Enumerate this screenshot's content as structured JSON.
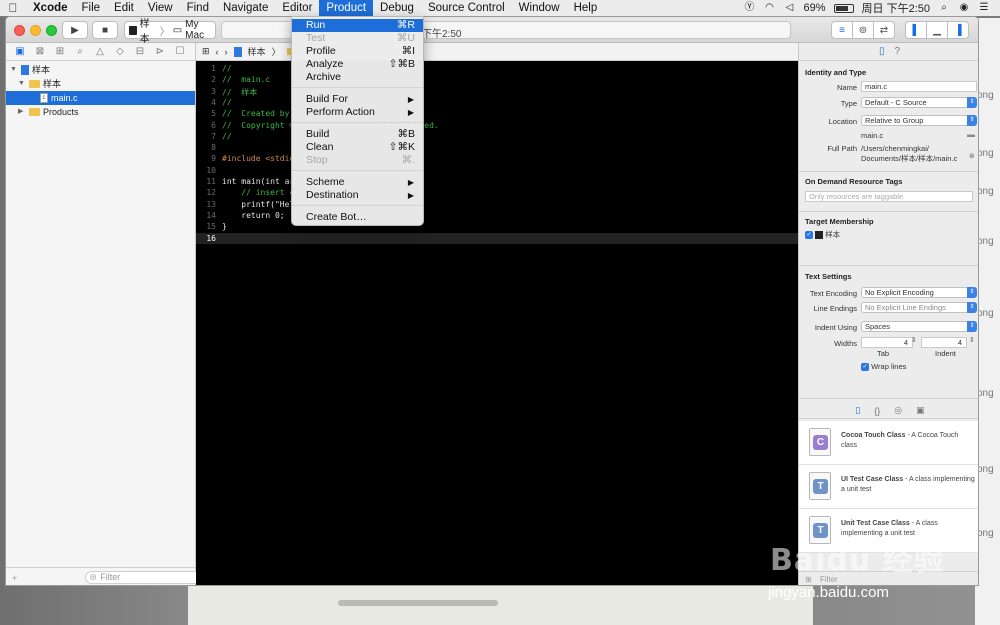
{
  "menubar": {
    "app": "Xcode",
    "items": [
      "File",
      "Edit",
      "View",
      "Find",
      "Navigate",
      "Editor",
      "Product",
      "Debug",
      "Source Control",
      "Window",
      "Help"
    ],
    "active": "Product",
    "battery": "69%",
    "clock": "周日 下午2:50"
  },
  "toolbar": {
    "scheme": "样本",
    "destination": "My Mac",
    "status_time": "下午2:50"
  },
  "navigator": {
    "project": "样本",
    "group": "样本",
    "file": "main.c",
    "products": "Products",
    "filter_placeholder": "Filter"
  },
  "jumpbar": {
    "crumb": "样本"
  },
  "editor": {
    "lines": [
      {
        "n": "1",
        "t": "//",
        "k": "cm"
      },
      {
        "n": "2",
        "t": "//  main.c",
        "k": "cm"
      },
      {
        "n": "3",
        "t": "//  样本",
        "k": "cm"
      },
      {
        "n": "4",
        "t": "//",
        "k": "cm"
      },
      {
        "n": "5",
        "t": "//  Created by",
        "k": "cm"
      },
      {
        "n": "6",
        "t": "//  Copyright ©                  ts reserved.",
        "k": "cm"
      },
      {
        "n": "7",
        "t": "//",
        "k": "cm"
      },
      {
        "n": "8",
        "t": "",
        "k": ""
      },
      {
        "n": "9",
        "t": "#include <stdio",
        "k": "pp"
      },
      {
        "n": "10",
        "t": "",
        "k": ""
      },
      {
        "n": "11",
        "t": "int main(int ar",
        "k": "code"
      },
      {
        "n": "12",
        "t": "    // insert c",
        "k": "cm"
      },
      {
        "n": "13",
        "t": "    printf(\"Hel",
        "k": "code"
      },
      {
        "n": "14",
        "t": "    return 0;",
        "k": "code"
      },
      {
        "n": "15",
        "t": "}",
        "k": ""
      },
      {
        "n": "16",
        "t": "",
        "k": ""
      }
    ]
  },
  "product_menu": {
    "items": [
      {
        "label": "Run",
        "shortcut": "⌘R",
        "state": "highlighted"
      },
      {
        "label": "Test",
        "shortcut": "⌘U",
        "state": "disabled"
      },
      {
        "label": "Profile",
        "shortcut": "⌘I",
        "state": "enabled"
      },
      {
        "label": "Analyze",
        "shortcut": "⇧⌘B",
        "state": "enabled"
      },
      {
        "label": "Archive",
        "shortcut": "",
        "state": "enabled"
      },
      {
        "label": "Build For",
        "shortcut": "▶",
        "state": "submenu"
      },
      {
        "label": "Perform Action",
        "shortcut": "▶",
        "state": "submenu"
      },
      {
        "label": "Build",
        "shortcut": "⌘B",
        "state": "enabled"
      },
      {
        "label": "Clean",
        "shortcut": "⇧⌘K",
        "state": "enabled"
      },
      {
        "label": "Stop",
        "shortcut": "⌘.",
        "state": "disabled"
      },
      {
        "label": "Scheme",
        "shortcut": "▶",
        "state": "submenu"
      },
      {
        "label": "Destination",
        "shortcut": "▶",
        "state": "submenu"
      },
      {
        "label": "Create Bot…",
        "shortcut": "",
        "state": "enabled"
      }
    ]
  },
  "inspector": {
    "identity_title": "Identity and Type",
    "name_label": "Name",
    "name_value": "main.c",
    "type_label": "Type",
    "type_value": "Default - C Source",
    "location_label": "Location",
    "location_value": "Relative to Group",
    "location_file": "main.c",
    "fullpath_label": "Full Path",
    "fullpath_line1": "/Users/chenmingkai/",
    "fullpath_line2": "Documents/样本/样本/main.c",
    "odr_title": "On Demand Resource Tags",
    "odr_placeholder": "Only resources are taggable",
    "target_title": "Target Membership",
    "target_name": "样本",
    "text_title": "Text Settings",
    "encoding_label": "Text Encoding",
    "encoding_value": "No Explicit Encoding",
    "endings_label": "Line Endings",
    "endings_value": "No Explicit Line Endings",
    "indent_label": "Indent Using",
    "indent_value": "Spaces",
    "widths_label": "Widths",
    "tab_value": "4",
    "indent_num": "4",
    "tab_caption": "Tab",
    "indent_caption": "Indent",
    "wrap_label": "Wrap lines",
    "library": [
      {
        "icon": "C",
        "name": "Cocoa Touch Class",
        "desc": " - A Cocoa Touch class"
      },
      {
        "icon": "T",
        "name": "UI Test Case Class",
        "desc": " - A class implementing a unit test"
      },
      {
        "icon": "T",
        "name": "Unit Test Case Class",
        "desc": " - A class implementing a unit test"
      }
    ],
    "filter_placeholder": "Filter"
  },
  "watermark": {
    "logo": "Baidu 经验",
    "url": "jingyan.baidu.com"
  },
  "desktop_side": [
    "ong",
    "ong",
    "ong",
    "ong",
    "ong",
    "ong",
    "ong",
    "ong"
  ],
  "colors": {
    "accent": "#1d6ed8",
    "comment": "#41b645",
    "editor_bg": "#000000"
  }
}
